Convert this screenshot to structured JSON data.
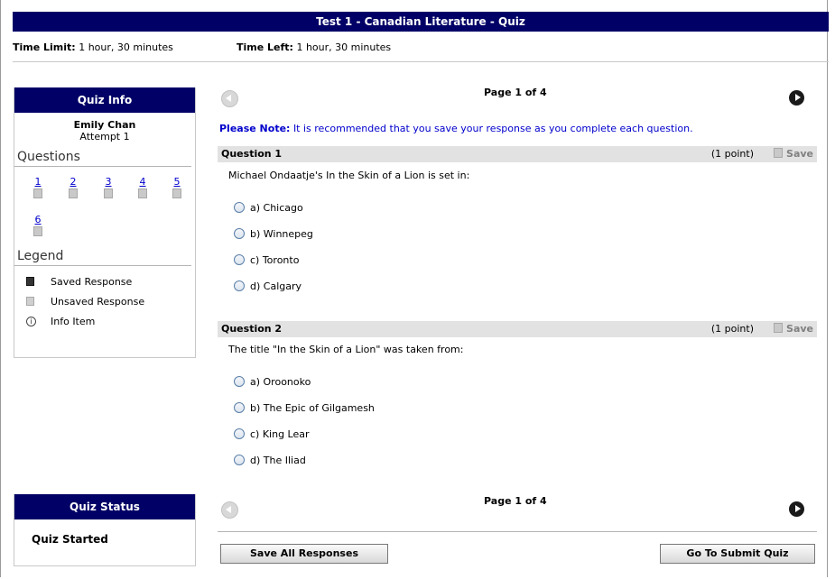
{
  "header": {
    "title": "Test 1 - Canadian Literature - Quiz",
    "time_limit_label": "Time Limit:",
    "time_limit_value": "1 hour, 30 minutes",
    "time_left_label": "Time Left:",
    "time_left_value": "1 hour, 30 minutes"
  },
  "sidebar": {
    "quiz_info_title": "Quiz Info",
    "student_name": "Emily Chan",
    "attempt": "Attempt 1",
    "questions_heading": "Questions",
    "questions": [
      "1",
      "2",
      "3",
      "4",
      "5",
      "6"
    ],
    "legend_heading": "Legend",
    "legend": {
      "saved": "Saved Response",
      "unsaved": "Unsaved Response",
      "info": "Info Item",
      "info_glyph": "i"
    },
    "quiz_status_title": "Quiz Status",
    "quiz_status": "Quiz Started"
  },
  "main": {
    "page_label": "Page 1 of 4",
    "note_label": "Please Note:",
    "note_text": "It is recommended that you save your response as you complete each question.",
    "questions": [
      {
        "title": "Question 1",
        "points": "(1 point)",
        "save_label": "Save",
        "text": "Michael Ondaatje's In the Skin of a Lion is set in:",
        "options": [
          "a) Chicago",
          "b) Winnepeg",
          "c) Toronto",
          "d) Calgary"
        ]
      },
      {
        "title": "Question 2",
        "points": "(1 point)",
        "save_label": "Save",
        "text": "The title \"In the Skin of a Lion\" was taken from:",
        "options": [
          "a) Oroonoko",
          "b) The Epic of Gilgamesh",
          "c) King Lear",
          "d) The Iliad"
        ]
      }
    ],
    "save_all_label": "Save All Responses",
    "submit_label": "Go To Submit Quiz"
  }
}
